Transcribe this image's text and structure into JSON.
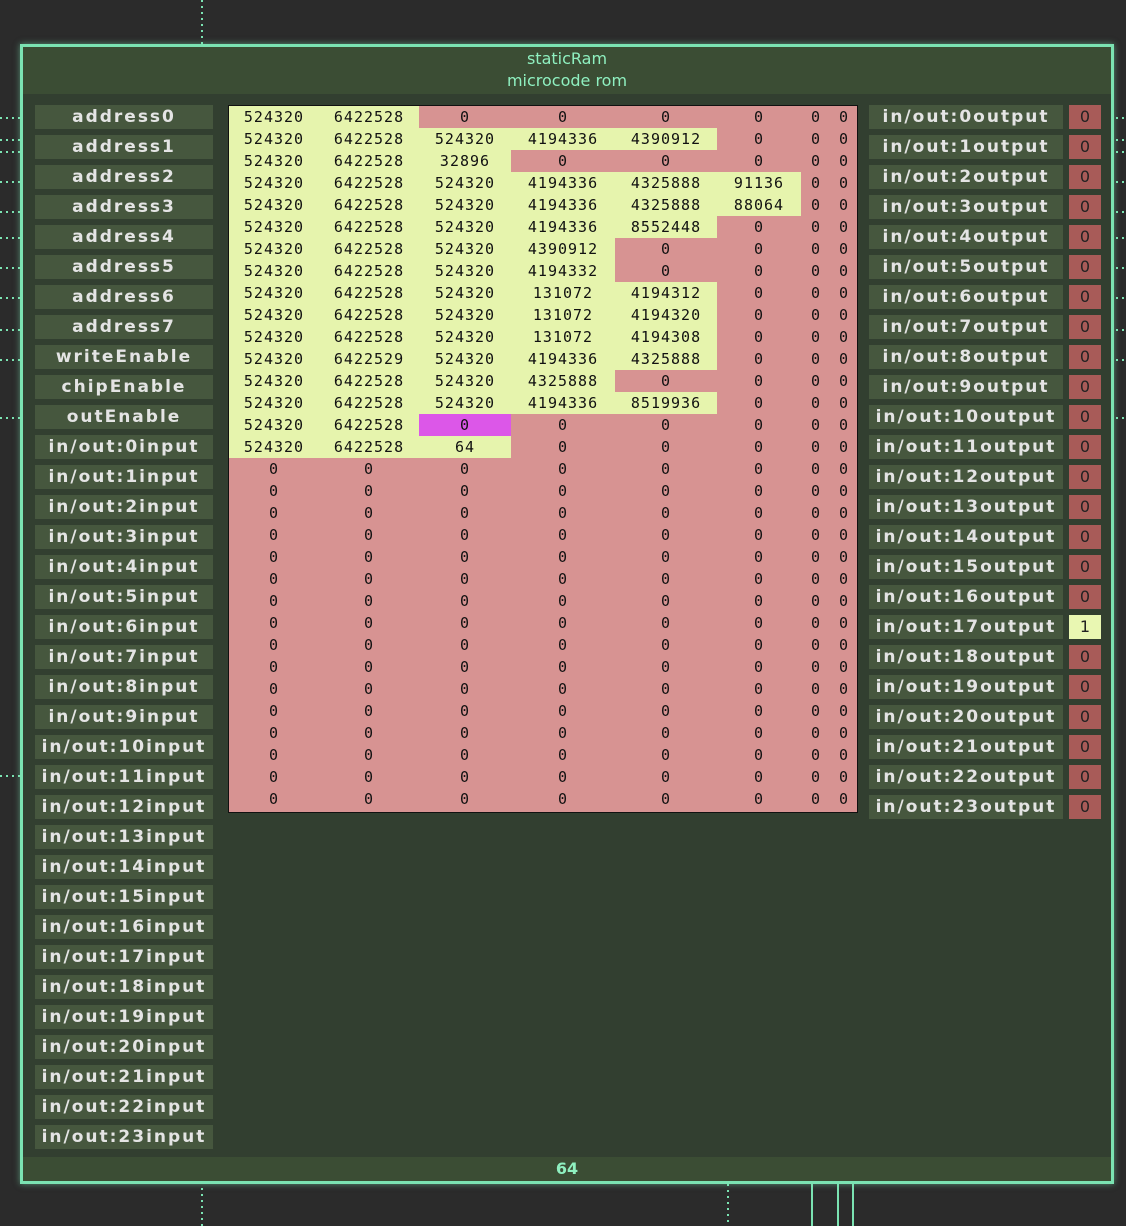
{
  "component": {
    "title": "staticRam",
    "subtitle": "microcode rom",
    "footer_value": "64"
  },
  "inputs": [
    "address0",
    "address1",
    "address2",
    "address3",
    "address4",
    "address5",
    "address6",
    "address7",
    "writeEnable",
    "chipEnable",
    "outEnable",
    "in/out:0input",
    "in/out:1input",
    "in/out:2input",
    "in/out:3input",
    "in/out:4input",
    "in/out:5input",
    "in/out:6input",
    "in/out:7input",
    "in/out:8input",
    "in/out:9input",
    "in/out:10input",
    "in/out:11input",
    "in/out:12input",
    "in/out:13input",
    "in/out:14input",
    "in/out:15input",
    "in/out:16input",
    "in/out:17input",
    "in/out:18input",
    "in/out:19input",
    "in/out:20input",
    "in/out:21input",
    "in/out:22input",
    "in/out:23input"
  ],
  "outputs": [
    {
      "label": "in/out:0output",
      "value": "0"
    },
    {
      "label": "in/out:1output",
      "value": "0"
    },
    {
      "label": "in/out:2output",
      "value": "0"
    },
    {
      "label": "in/out:3output",
      "value": "0"
    },
    {
      "label": "in/out:4output",
      "value": "0"
    },
    {
      "label": "in/out:5output",
      "value": "0"
    },
    {
      "label": "in/out:6output",
      "value": "0"
    },
    {
      "label": "in/out:7output",
      "value": "0"
    },
    {
      "label": "in/out:8output",
      "value": "0"
    },
    {
      "label": "in/out:9output",
      "value": "0"
    },
    {
      "label": "in/out:10output",
      "value": "0"
    },
    {
      "label": "in/out:11output",
      "value": "0"
    },
    {
      "label": "in/out:12output",
      "value": "0"
    },
    {
      "label": "in/out:13output",
      "value": "0"
    },
    {
      "label": "in/out:14output",
      "value": "0"
    },
    {
      "label": "in/out:15output",
      "value": "0"
    },
    {
      "label": "in/out:16output",
      "value": "0"
    },
    {
      "label": "in/out:17output",
      "value": "1"
    },
    {
      "label": "in/out:18output",
      "value": "0"
    },
    {
      "label": "in/out:19output",
      "value": "0"
    },
    {
      "label": "in/out:20output",
      "value": "0"
    },
    {
      "label": "in/out:21output",
      "value": "0"
    },
    {
      "label": "in/out:22output",
      "value": "0"
    },
    {
      "label": "in/out:23output",
      "value": "0"
    }
  ],
  "memory": {
    "selected": [
      14,
      2
    ],
    "rows": [
      [
        "524320",
        "6422528",
        "0",
        "0",
        "0",
        "0",
        "0",
        "0"
      ],
      [
        "524320",
        "6422528",
        "524320",
        "4194336",
        "4390912",
        "0",
        "0",
        "0"
      ],
      [
        "524320",
        "6422528",
        "32896",
        "0",
        "0",
        "0",
        "0",
        "0"
      ],
      [
        "524320",
        "6422528",
        "524320",
        "4194336",
        "4325888",
        "91136",
        "0",
        "0"
      ],
      [
        "524320",
        "6422528",
        "524320",
        "4194336",
        "4325888",
        "88064",
        "0",
        "0"
      ],
      [
        "524320",
        "6422528",
        "524320",
        "4194336",
        "8552448",
        "0",
        "0",
        "0"
      ],
      [
        "524320",
        "6422528",
        "524320",
        "4390912",
        "0",
        "0",
        "0",
        "0"
      ],
      [
        "524320",
        "6422528",
        "524320",
        "4194332",
        "0",
        "0",
        "0",
        "0"
      ],
      [
        "524320",
        "6422528",
        "524320",
        "131072",
        "4194312",
        "0",
        "0",
        "0"
      ],
      [
        "524320",
        "6422528",
        "524320",
        "131072",
        "4194320",
        "0",
        "0",
        "0"
      ],
      [
        "524320",
        "6422528",
        "524320",
        "131072",
        "4194308",
        "0",
        "0",
        "0"
      ],
      [
        "524320",
        "6422529",
        "524320",
        "4194336",
        "4325888",
        "0",
        "0",
        "0"
      ],
      [
        "524320",
        "6422528",
        "524320",
        "4325888",
        "0",
        "0",
        "0",
        "0"
      ],
      [
        "524320",
        "6422528",
        "524320",
        "4194336",
        "8519936",
        "0",
        "0",
        "0"
      ],
      [
        "524320",
        "6422528",
        "0",
        "0",
        "0",
        "0",
        "0",
        "0"
      ],
      [
        "524320",
        "6422528",
        "64",
        "0",
        "0",
        "0",
        "0",
        "0"
      ],
      [
        "0",
        "0",
        "0",
        "0",
        "0",
        "0",
        "0",
        "0"
      ],
      [
        "0",
        "0",
        "0",
        "0",
        "0",
        "0",
        "0",
        "0"
      ],
      [
        "0",
        "0",
        "0",
        "0",
        "0",
        "0",
        "0",
        "0"
      ],
      [
        "0",
        "0",
        "0",
        "0",
        "0",
        "0",
        "0",
        "0"
      ],
      [
        "0",
        "0",
        "0",
        "0",
        "0",
        "0",
        "0",
        "0"
      ],
      [
        "0",
        "0",
        "0",
        "0",
        "0",
        "0",
        "0",
        "0"
      ],
      [
        "0",
        "0",
        "0",
        "0",
        "0",
        "0",
        "0",
        "0"
      ],
      [
        "0",
        "0",
        "0",
        "0",
        "0",
        "0",
        "0",
        "0"
      ],
      [
        "0",
        "0",
        "0",
        "0",
        "0",
        "0",
        "0",
        "0"
      ],
      [
        "0",
        "0",
        "0",
        "0",
        "0",
        "0",
        "0",
        "0"
      ],
      [
        "0",
        "0",
        "0",
        "0",
        "0",
        "0",
        "0",
        "0"
      ],
      [
        "0",
        "0",
        "0",
        "0",
        "0",
        "0",
        "0",
        "0"
      ],
      [
        "0",
        "0",
        "0",
        "0",
        "0",
        "0",
        "0",
        "0"
      ],
      [
        "0",
        "0",
        "0",
        "0",
        "0",
        "0",
        "0",
        "0"
      ],
      [
        "0",
        "0",
        "0",
        "0",
        "0",
        "0",
        "0",
        "0"
      ],
      [
        "0",
        "0",
        "0",
        "0",
        "0",
        "0",
        "0",
        "0"
      ]
    ]
  },
  "colors": {
    "border": "#7be3b2",
    "panel": "#323f30",
    "pin": "#46573e",
    "cell_zero": "#d79392",
    "cell_nonzero": "#e6f4ad",
    "cell_selected": "#dc57e8",
    "out_low": "#a85b58",
    "out_high": "#e9f7b2"
  }
}
